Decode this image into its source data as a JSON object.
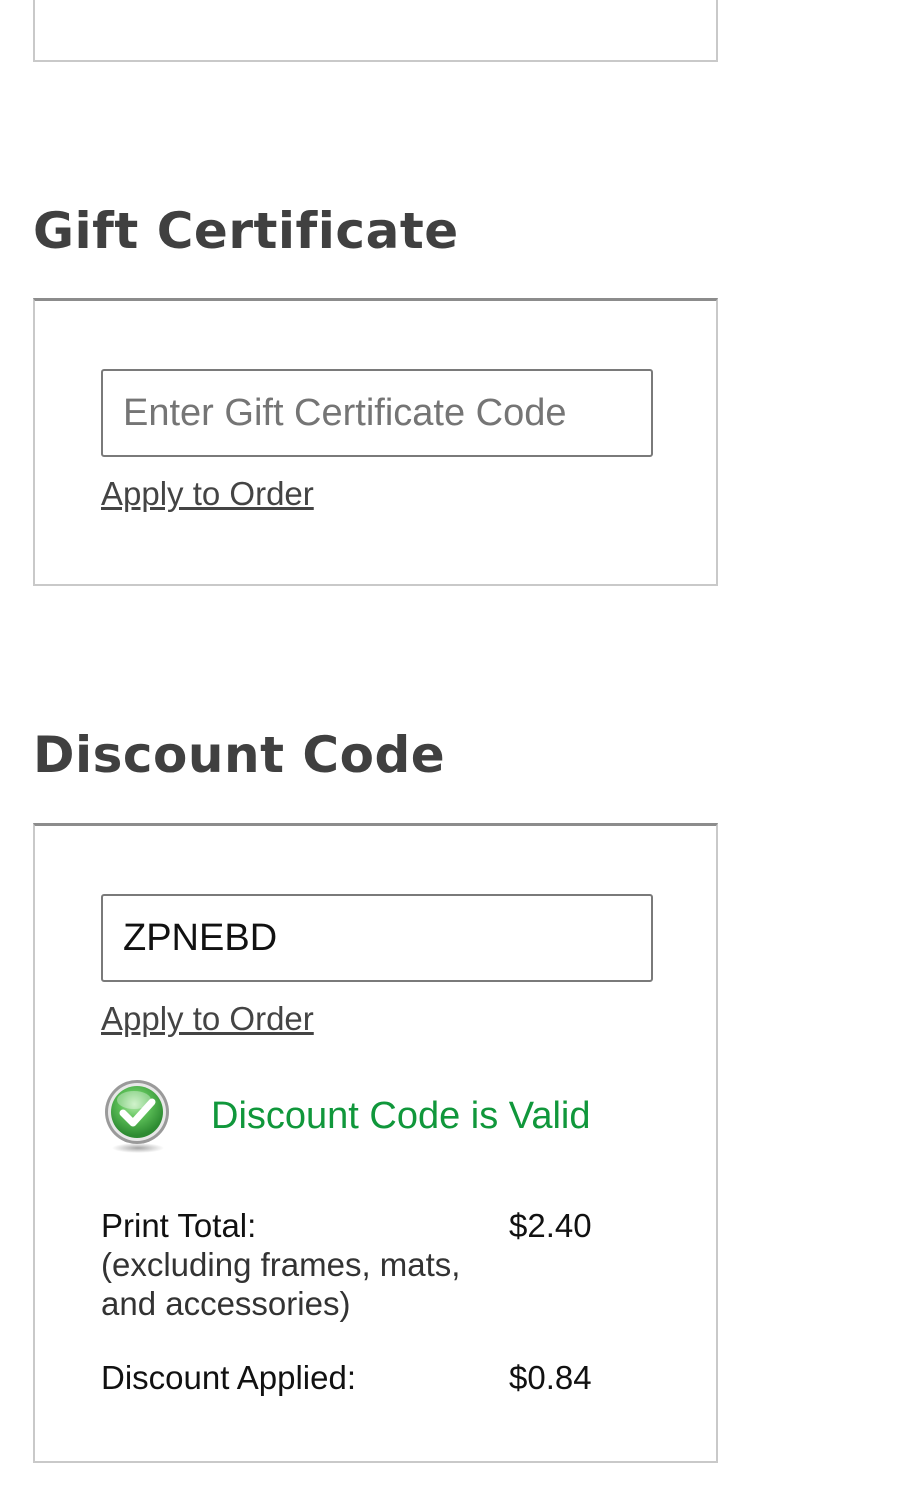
{
  "gift_certificate": {
    "title": "Gift Certificate",
    "input_placeholder": "Enter Gift Certificate Code",
    "input_value": "",
    "apply_label": "Apply to Order"
  },
  "discount_code": {
    "title": "Discount Code",
    "input_placeholder": "",
    "input_value": "ZPNEBD",
    "apply_label": "Apply to Order",
    "status_icon": "check-circle-icon",
    "status_text": "Discount Code is Valid",
    "print_total_label": "Print Total:",
    "print_total_note": "(excluding frames, mats, and accessories)",
    "print_total_value": "$2.40",
    "discount_applied_label": "Discount Applied:",
    "discount_applied_value": "$0.84"
  },
  "colors": {
    "valid_green": "#10973b",
    "heading": "#404040",
    "panel_border": "#c9c9c9",
    "panel_top_border": "#8c8c8c"
  }
}
